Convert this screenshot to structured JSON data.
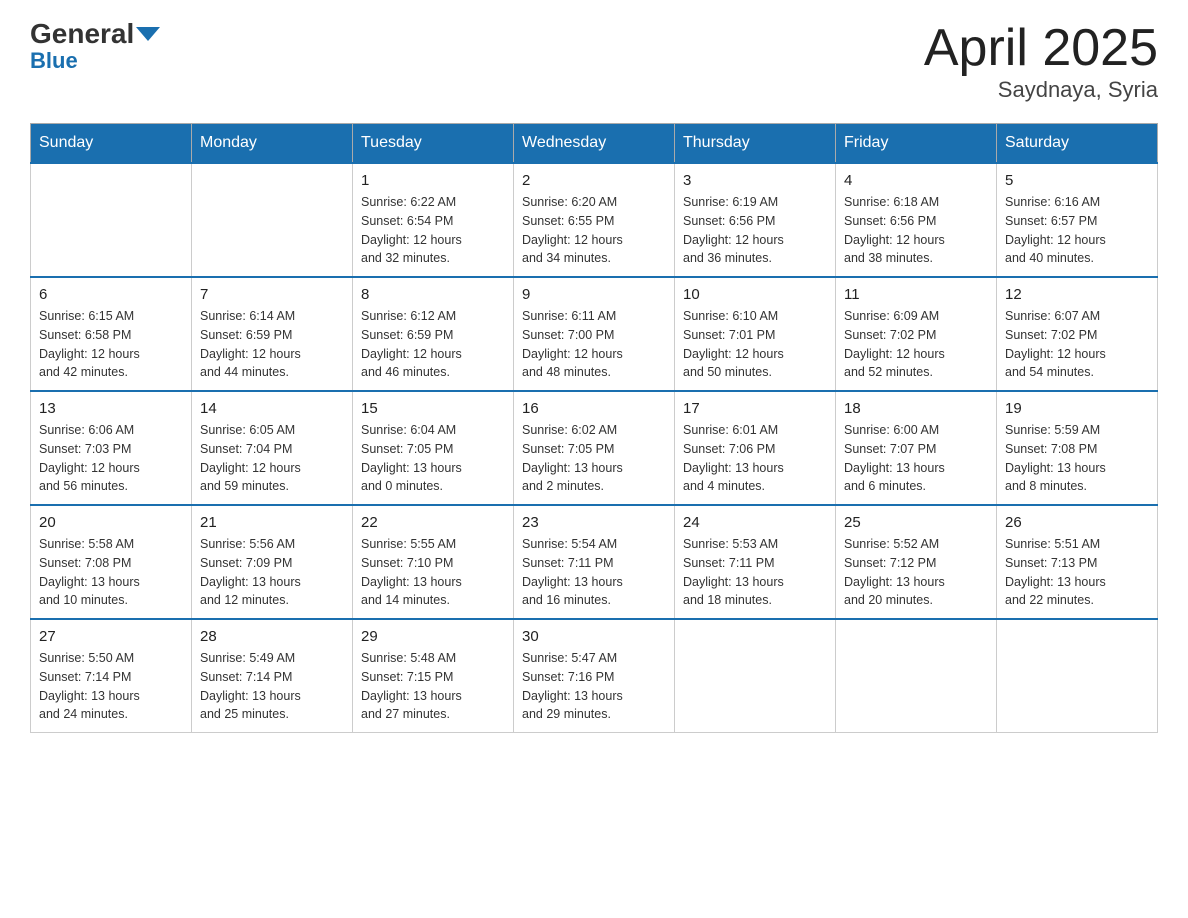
{
  "logo": {
    "text1": "General",
    "text2": "Blue"
  },
  "title": "April 2025",
  "subtitle": "Saydnaya, Syria",
  "days_header": [
    "Sunday",
    "Monday",
    "Tuesday",
    "Wednesday",
    "Thursday",
    "Friday",
    "Saturday"
  ],
  "weeks": [
    [
      {
        "day": "",
        "info": ""
      },
      {
        "day": "",
        "info": ""
      },
      {
        "day": "1",
        "info": "Sunrise: 6:22 AM\nSunset: 6:54 PM\nDaylight: 12 hours\nand 32 minutes."
      },
      {
        "day": "2",
        "info": "Sunrise: 6:20 AM\nSunset: 6:55 PM\nDaylight: 12 hours\nand 34 minutes."
      },
      {
        "day": "3",
        "info": "Sunrise: 6:19 AM\nSunset: 6:56 PM\nDaylight: 12 hours\nand 36 minutes."
      },
      {
        "day": "4",
        "info": "Sunrise: 6:18 AM\nSunset: 6:56 PM\nDaylight: 12 hours\nand 38 minutes."
      },
      {
        "day": "5",
        "info": "Sunrise: 6:16 AM\nSunset: 6:57 PM\nDaylight: 12 hours\nand 40 minutes."
      }
    ],
    [
      {
        "day": "6",
        "info": "Sunrise: 6:15 AM\nSunset: 6:58 PM\nDaylight: 12 hours\nand 42 minutes."
      },
      {
        "day": "7",
        "info": "Sunrise: 6:14 AM\nSunset: 6:59 PM\nDaylight: 12 hours\nand 44 minutes."
      },
      {
        "day": "8",
        "info": "Sunrise: 6:12 AM\nSunset: 6:59 PM\nDaylight: 12 hours\nand 46 minutes."
      },
      {
        "day": "9",
        "info": "Sunrise: 6:11 AM\nSunset: 7:00 PM\nDaylight: 12 hours\nand 48 minutes."
      },
      {
        "day": "10",
        "info": "Sunrise: 6:10 AM\nSunset: 7:01 PM\nDaylight: 12 hours\nand 50 minutes."
      },
      {
        "day": "11",
        "info": "Sunrise: 6:09 AM\nSunset: 7:02 PM\nDaylight: 12 hours\nand 52 minutes."
      },
      {
        "day": "12",
        "info": "Sunrise: 6:07 AM\nSunset: 7:02 PM\nDaylight: 12 hours\nand 54 minutes."
      }
    ],
    [
      {
        "day": "13",
        "info": "Sunrise: 6:06 AM\nSunset: 7:03 PM\nDaylight: 12 hours\nand 56 minutes."
      },
      {
        "day": "14",
        "info": "Sunrise: 6:05 AM\nSunset: 7:04 PM\nDaylight: 12 hours\nand 59 minutes."
      },
      {
        "day": "15",
        "info": "Sunrise: 6:04 AM\nSunset: 7:05 PM\nDaylight: 13 hours\nand 0 minutes."
      },
      {
        "day": "16",
        "info": "Sunrise: 6:02 AM\nSunset: 7:05 PM\nDaylight: 13 hours\nand 2 minutes."
      },
      {
        "day": "17",
        "info": "Sunrise: 6:01 AM\nSunset: 7:06 PM\nDaylight: 13 hours\nand 4 minutes."
      },
      {
        "day": "18",
        "info": "Sunrise: 6:00 AM\nSunset: 7:07 PM\nDaylight: 13 hours\nand 6 minutes."
      },
      {
        "day": "19",
        "info": "Sunrise: 5:59 AM\nSunset: 7:08 PM\nDaylight: 13 hours\nand 8 minutes."
      }
    ],
    [
      {
        "day": "20",
        "info": "Sunrise: 5:58 AM\nSunset: 7:08 PM\nDaylight: 13 hours\nand 10 minutes."
      },
      {
        "day": "21",
        "info": "Sunrise: 5:56 AM\nSunset: 7:09 PM\nDaylight: 13 hours\nand 12 minutes."
      },
      {
        "day": "22",
        "info": "Sunrise: 5:55 AM\nSunset: 7:10 PM\nDaylight: 13 hours\nand 14 minutes."
      },
      {
        "day": "23",
        "info": "Sunrise: 5:54 AM\nSunset: 7:11 PM\nDaylight: 13 hours\nand 16 minutes."
      },
      {
        "day": "24",
        "info": "Sunrise: 5:53 AM\nSunset: 7:11 PM\nDaylight: 13 hours\nand 18 minutes."
      },
      {
        "day": "25",
        "info": "Sunrise: 5:52 AM\nSunset: 7:12 PM\nDaylight: 13 hours\nand 20 minutes."
      },
      {
        "day": "26",
        "info": "Sunrise: 5:51 AM\nSunset: 7:13 PM\nDaylight: 13 hours\nand 22 minutes."
      }
    ],
    [
      {
        "day": "27",
        "info": "Sunrise: 5:50 AM\nSunset: 7:14 PM\nDaylight: 13 hours\nand 24 minutes."
      },
      {
        "day": "28",
        "info": "Sunrise: 5:49 AM\nSunset: 7:14 PM\nDaylight: 13 hours\nand 25 minutes."
      },
      {
        "day": "29",
        "info": "Sunrise: 5:48 AM\nSunset: 7:15 PM\nDaylight: 13 hours\nand 27 minutes."
      },
      {
        "day": "30",
        "info": "Sunrise: 5:47 AM\nSunset: 7:16 PM\nDaylight: 13 hours\nand 29 minutes."
      },
      {
        "day": "",
        "info": ""
      },
      {
        "day": "",
        "info": ""
      },
      {
        "day": "",
        "info": ""
      }
    ]
  ]
}
